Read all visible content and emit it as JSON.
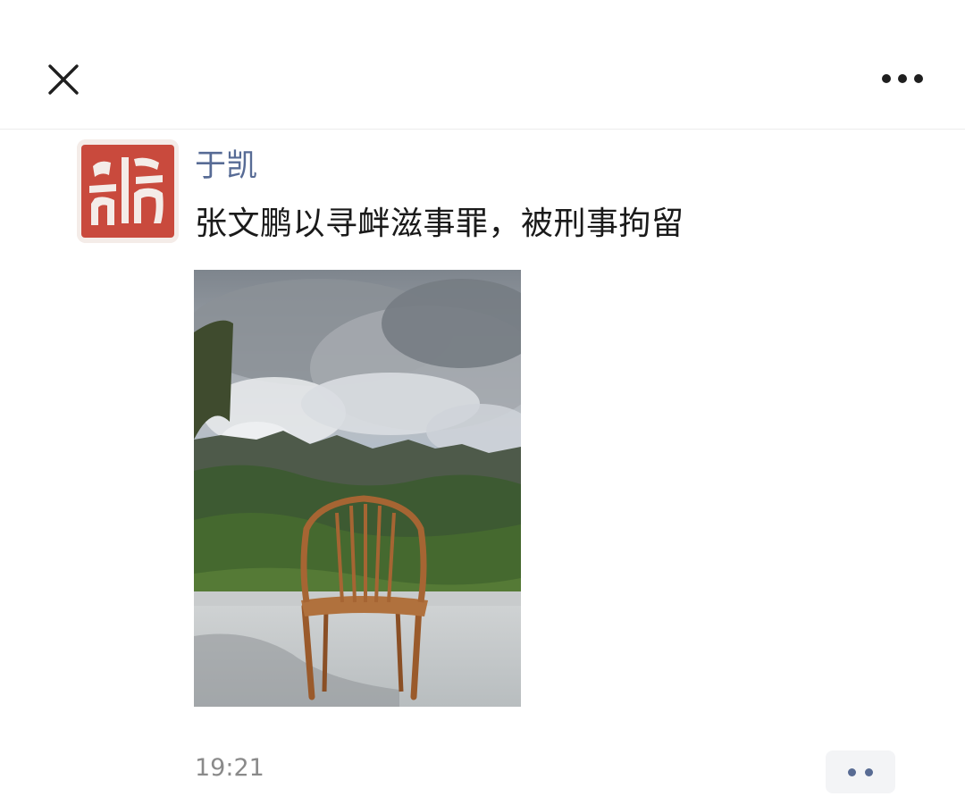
{
  "header": {
    "close_icon": "close-icon",
    "more_icon": "more-horizontal-icon"
  },
  "post": {
    "avatar": {
      "type": "seal-stamp",
      "text": "凯",
      "color": "#c94a3d"
    },
    "author": "于凯",
    "author_color": "#576b95",
    "text": "张文鹏以寻衅滋事罪，被刑事拘留",
    "photo_icon": "photo",
    "time": "19:21",
    "action_icon": "comment-like-icon"
  }
}
